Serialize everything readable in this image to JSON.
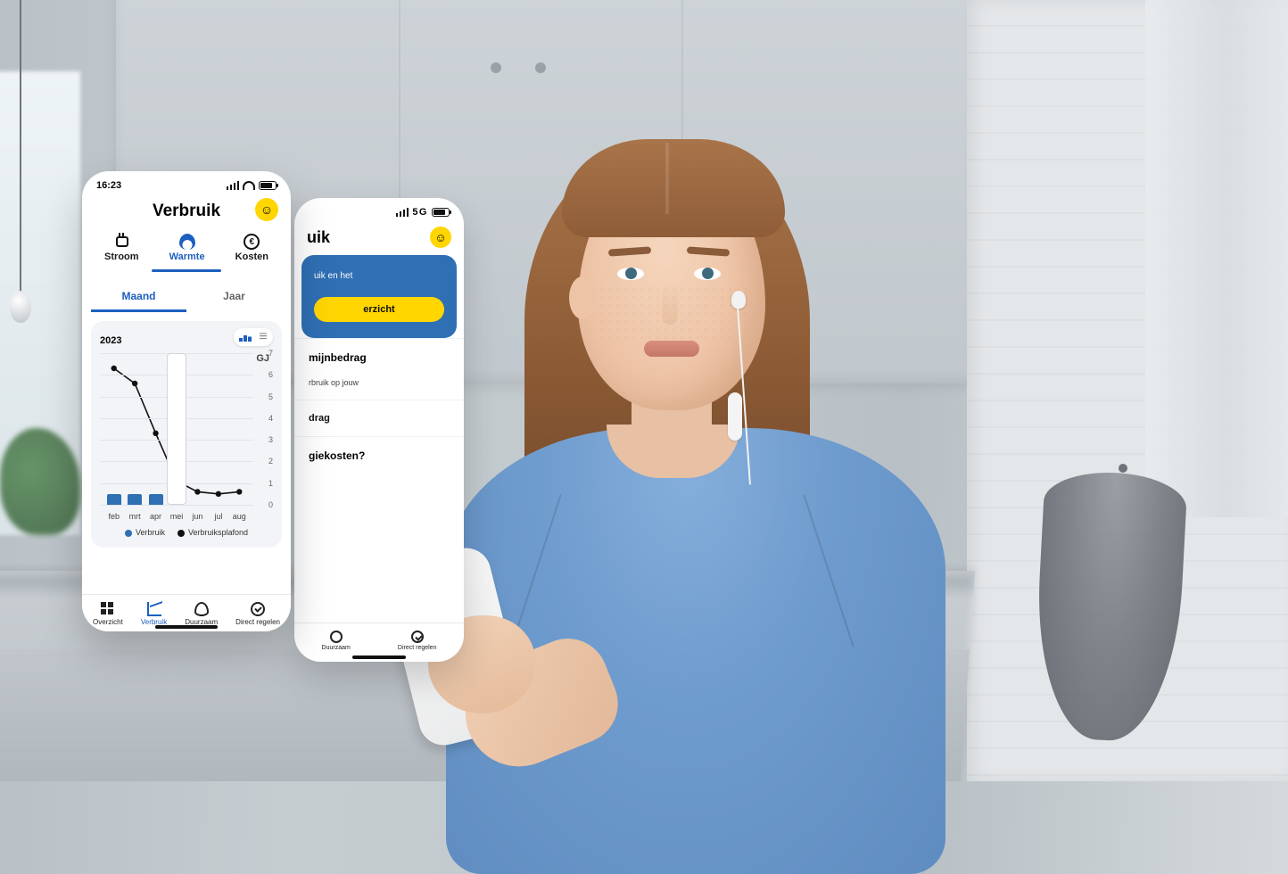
{
  "colors": {
    "accent_blue": "#2f6fb3",
    "brand_yellow": "#ffd600",
    "link_blue": "#1d5fbf"
  },
  "phone_front": {
    "status_time": "16:23",
    "title": "Verbruik",
    "tabs": [
      {
        "label": "Stroom"
      },
      {
        "label": "Warmte"
      },
      {
        "label": "Kosten"
      }
    ],
    "subtabs": {
      "month": "Maand",
      "year": "Jaar"
    },
    "chart_year": "2023",
    "chart_unit": "GJ",
    "legend": {
      "usage": "Verbruik",
      "cap": "Verbruiksplafond"
    },
    "bottom_nav": [
      {
        "label": "Overzicht"
      },
      {
        "label": "Verbruik"
      },
      {
        "label": "Duurzaam"
      },
      {
        "label": "Direct regelen"
      }
    ]
  },
  "phone_back": {
    "status_network": "5G",
    "title_fragment": "uik",
    "blue_card_text": "uik en het",
    "cta_label": "erzicht",
    "row_heading": "mijnbedrag",
    "row_sub": "rbruik op jouw",
    "row_link": "drag",
    "footer_q": "giekosten?",
    "bottom_nav": [
      {
        "label": "Duurzaam"
      },
      {
        "label": "Direct regelen"
      }
    ]
  },
  "chart_data": {
    "type": "bar+line",
    "title": "Verbruik — Warmte",
    "xlabel": "",
    "ylabel": "GJ",
    "ylim": [
      0,
      7
    ],
    "yticks": [
      0,
      1,
      2,
      3,
      4,
      5,
      6,
      7
    ],
    "categories": [
      "feb",
      "mrt",
      "apr",
      "mei",
      "jun",
      "jul",
      "aug"
    ],
    "selected_category": "mei",
    "series": [
      {
        "name": "Verbruik",
        "type": "bar",
        "color": "#2f6fb3",
        "values": [
          0.5,
          0.5,
          0.5,
          null,
          null,
          null,
          null
        ]
      },
      {
        "name": "Verbruiksplafond",
        "type": "line",
        "color": "#111111",
        "values": [
          6.3,
          5.6,
          3.3,
          1.1,
          0.6,
          0.5,
          0.6
        ]
      }
    ]
  }
}
